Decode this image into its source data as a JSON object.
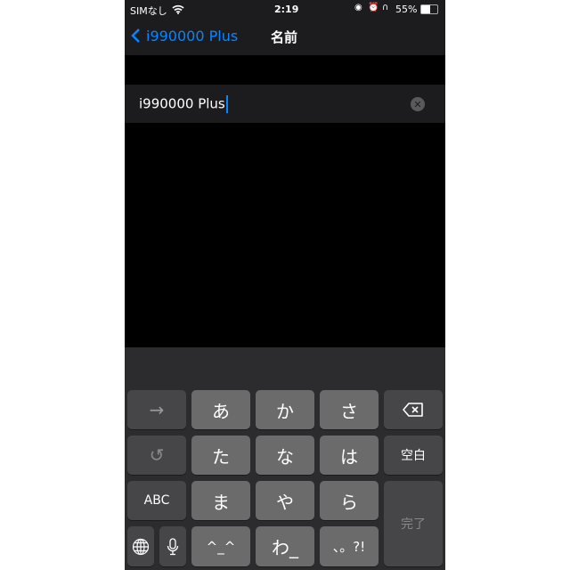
{
  "status_bar": {
    "carrier": "SIMなし",
    "time": "2:19",
    "battery": "55%",
    "icons": [
      "wifi-icon",
      "orientation-lock-icon",
      "alarm-icon",
      "headphones-icon",
      "battery-icon"
    ]
  },
  "nav": {
    "back_label": "i990000 Plus",
    "title": "名前"
  },
  "field": {
    "value": "i990000 Plus"
  },
  "keyboard": {
    "next": "→",
    "a": "あ",
    "ka": "か",
    "sa": "さ",
    "ta": "た",
    "na": "な",
    "ha": "は",
    "abc": "ABC",
    "ma": "ま",
    "ya": "や",
    "ra": "ら",
    "space": "空白",
    "done": "完了",
    "kaomoji": "^_^",
    "wa": "わ_",
    "punct": "、。?!"
  },
  "colors": {
    "accent": "#0a84ff",
    "key": "#6b6b6b",
    "fn_key": "#464648"
  }
}
